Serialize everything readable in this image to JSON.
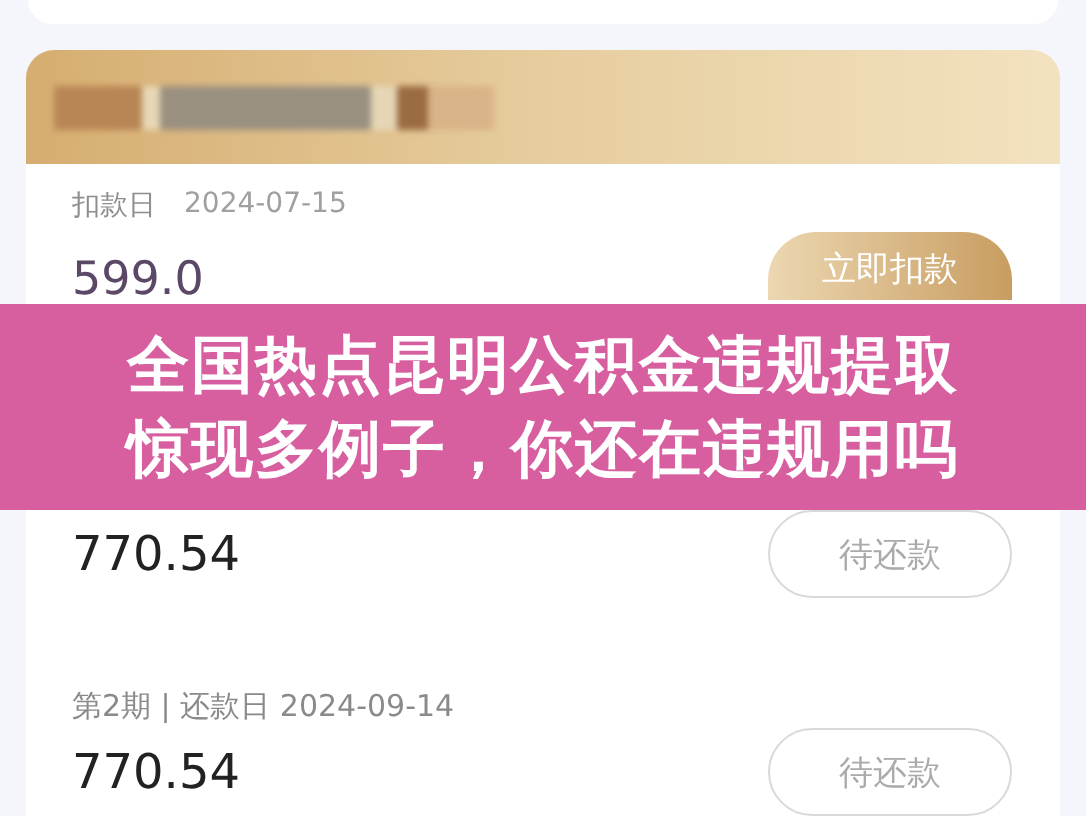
{
  "deduction": {
    "label": "扣款日",
    "date": "2024-07-15",
    "amount": "599.0",
    "button": "立即扣款"
  },
  "installments": [
    {
      "amount": "770.54",
      "button": "待还款"
    },
    {
      "period": "第2期 | 还款日 2024-09-14",
      "amount": "770.54",
      "button": "待还款"
    }
  ],
  "banner": {
    "lines": [
      "全国热点昆明公积金违规提取",
      "惊现多例子，你还在违规用吗"
    ]
  }
}
